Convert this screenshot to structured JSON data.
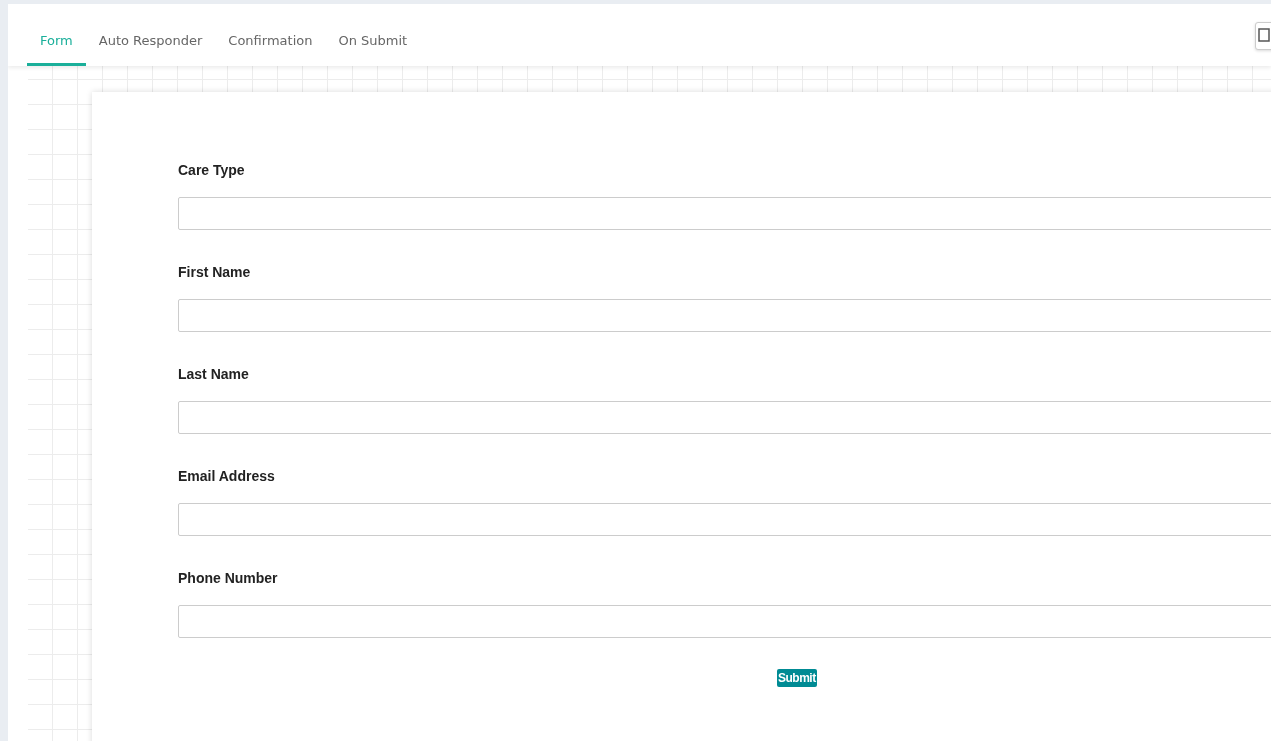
{
  "tabs": [
    {
      "label": "Form",
      "selected": true
    },
    {
      "label": "Auto Responder",
      "selected": false
    },
    {
      "label": "Confirmation",
      "selected": false
    },
    {
      "label": "On Submit",
      "selected": false
    }
  ],
  "form": {
    "fields": [
      {
        "label": "Care Type"
      },
      {
        "label": "First Name"
      },
      {
        "label": "Last Name"
      },
      {
        "label": "Email Address"
      },
      {
        "label": "Phone Number"
      }
    ],
    "submit": "Submit"
  }
}
